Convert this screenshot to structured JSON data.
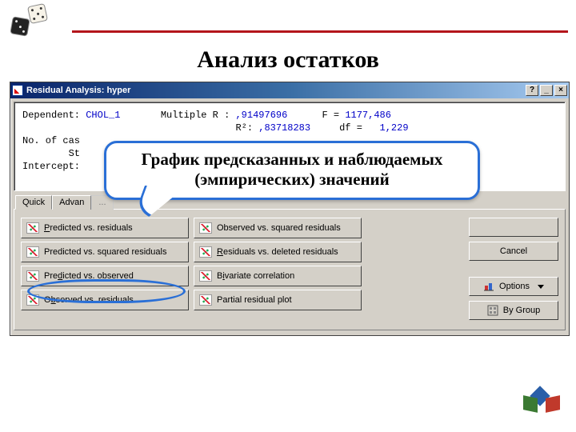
{
  "page": {
    "heading": "Анализ остатков"
  },
  "window": {
    "title": "Residual Analysis: hyper",
    "help_label": "?",
    "minimize_label": "_",
    "close_label": "×"
  },
  "stats": {
    "dependent_label": "Dependent:",
    "dependent_value": "CHOL_1",
    "multr_label": "Multiple R :",
    "multr_value": ",91497696",
    "f_label": "F",
    "f_value": "1177,486",
    "r2_label": "R²:",
    "r2_value": ",83718283",
    "df_label": "df",
    "df_sep": "=",
    "df_value": "1,229",
    "ncases_label": "No. of cas",
    "st_label": "St",
    "intercept_label": "Intercept:"
  },
  "tabs": {
    "quick": "Quick",
    "advanced": "Advan",
    "tail": "..."
  },
  "buttons": {
    "pred_vs_resid": "Predicted vs. residuals",
    "obs_vs_sqresid": "Observed vs. squared residuals",
    "pred_vs_sqresid": "Predicted vs. squared residuals",
    "resid_vs_delresid": "Residuals vs. deleted residuals",
    "pred_vs_obs": "Predicted vs. observed",
    "bivar": "Bivariate correlation",
    "obs_vs_resid": "Observed vs. residuals",
    "partial": "Partial residual plot"
  },
  "sidebar": {
    "cancel": "Cancel",
    "options": "Options",
    "bygroup": "By Group"
  },
  "callout": {
    "line1": "График предсказанных и наблюдаемых",
    "line2": "(эмпирических) значений"
  }
}
